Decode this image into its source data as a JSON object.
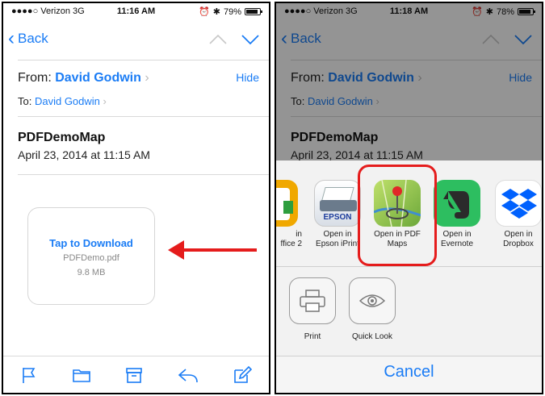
{
  "left": {
    "status": {
      "carrier": "●●●●○ Verizon  3G",
      "time": "11:16 AM",
      "battery": "79%",
      "battery_level": 0.79
    },
    "nav": {
      "back": "Back"
    },
    "header": {
      "from_label": "From: ",
      "from_name": "David Godwin",
      "hide": "Hide",
      "to_label": "To: ",
      "to_name": "David Godwin"
    },
    "message": {
      "subject": "PDFDemoMap",
      "date": "April 23, 2014 at 11:15 AM"
    },
    "attachment": {
      "action": "Tap to Download",
      "filename": "PDFDemo.pdf",
      "size": "9.8 MB"
    }
  },
  "right": {
    "status": {
      "carrier": "●●●●○ Verizon  3G",
      "time": "11:18 AM",
      "battery": "78%",
      "battery_level": 0.78
    },
    "nav": {
      "back": "Back"
    },
    "header": {
      "from_label": "From: ",
      "from_name": "David Godwin",
      "hide": "Hide",
      "to_label": "To: ",
      "to_name": "David Godwin"
    },
    "message": {
      "subject": "PDFDemoMap",
      "date": "April 23, 2014 at 11:15 AM"
    },
    "share_sheet": {
      "apps": [
        {
          "line1": "in",
          "line2": "ffice 2",
          "icon": "office-app-icon"
        },
        {
          "line1": "Open in",
          "line2": "Epson iPrint",
          "icon": "epson-printer-icon",
          "badge": "EPSON"
        },
        {
          "line1": "Open in PDF",
          "line2": "Maps",
          "icon": "pdf-maps-icon"
        },
        {
          "line1": "Open in",
          "line2": "Evernote",
          "icon": "evernote-elephant-icon"
        },
        {
          "line1": "Open in",
          "line2": "Dropbox",
          "icon": "dropbox-icon"
        }
      ],
      "actions": [
        {
          "label": "Print",
          "icon": "printer-icon"
        },
        {
          "label": "Quick Look",
          "icon": "eye-icon"
        }
      ],
      "cancel": "Cancel"
    }
  },
  "colors": {
    "ios_blue": "#1a7cf5",
    "highlight_red": "#e51c1c",
    "evernote_green": "#2dbe60",
    "dropbox_blue": "#0061fe"
  }
}
